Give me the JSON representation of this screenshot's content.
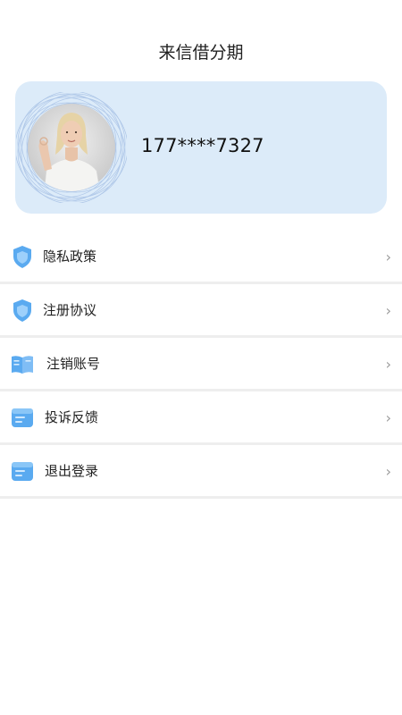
{
  "header": {
    "title": "来信借分期"
  },
  "profile": {
    "phone": "177****7327"
  },
  "menu": {
    "items": [
      {
        "label": "隐私政策",
        "icon": "shield-icon"
      },
      {
        "label": "注册协议",
        "icon": "shield-icon"
      },
      {
        "label": "注销账号",
        "icon": "book-icon"
      },
      {
        "label": "投诉反馈",
        "icon": "document-icon"
      },
      {
        "label": "退出登录",
        "icon": "document-icon"
      }
    ],
    "chevron": "›"
  },
  "colors": {
    "card_bg": "#dcebf9",
    "icon_blue": "#5aaaf0"
  }
}
